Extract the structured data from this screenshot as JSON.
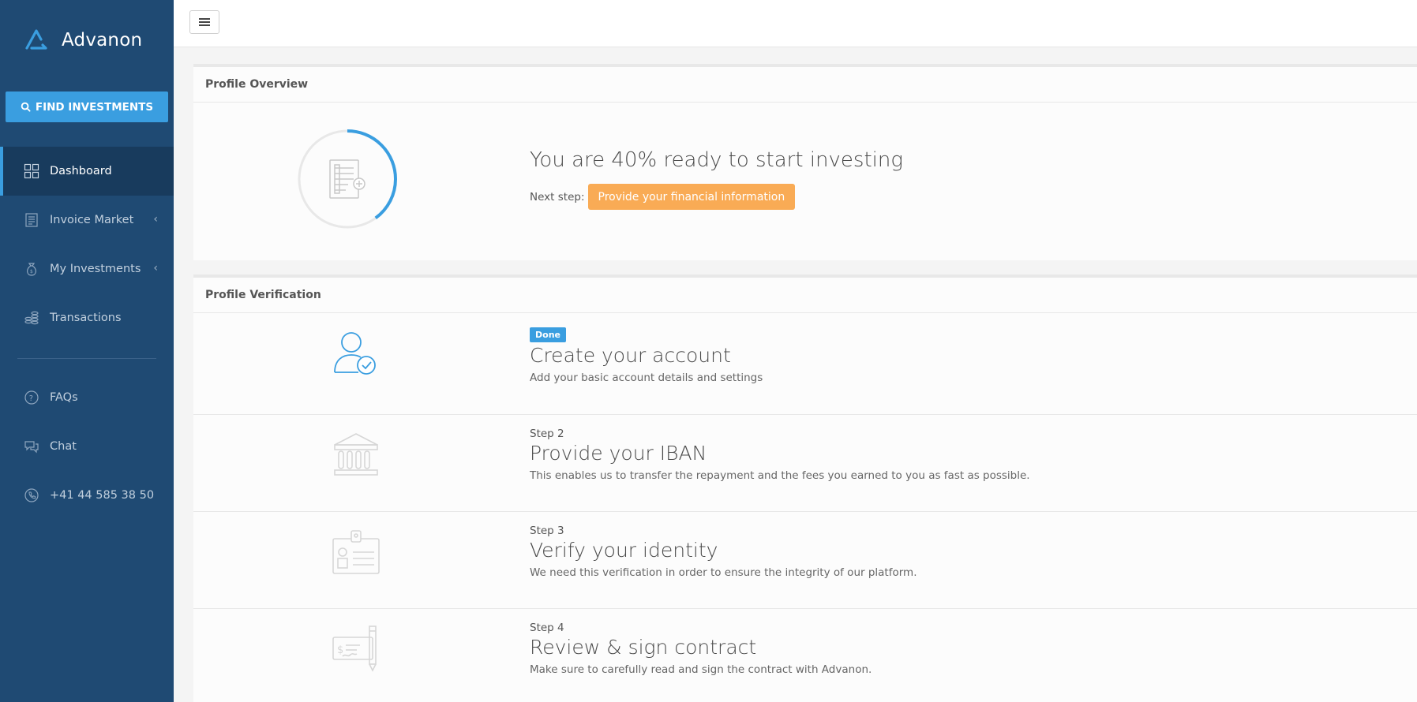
{
  "brand": {
    "name": "Advanon"
  },
  "sidebar": {
    "find_button": "FIND INVESTMENTS",
    "items": [
      {
        "label": "Dashboard",
        "icon": "dashboard-grid-icon",
        "active": true
      },
      {
        "label": "Invoice Market",
        "icon": "invoice-icon",
        "has_submenu": true
      },
      {
        "label": "My Investments",
        "icon": "money-bag-icon",
        "has_submenu": true
      },
      {
        "label": "Transactions",
        "icon": "coins-icon"
      }
    ],
    "secondary": [
      {
        "label": "FAQs",
        "icon": "question-circle-icon"
      },
      {
        "label": "Chat",
        "icon": "chat-icon"
      },
      {
        "label": "+41 44 585 38 50",
        "icon": "phone-icon"
      }
    ],
    "submenu_chevron": "‹"
  },
  "overview": {
    "heading": "Profile Overview",
    "ready_text": "You are 40% ready to start investing",
    "progress_percent": 40,
    "next_step_label": "Next step:",
    "next_step_button": "Provide your financial information"
  },
  "verification": {
    "heading": "Profile Verification",
    "steps": [
      {
        "badge": "Done",
        "title": "Create your account",
        "desc": "Add your basic account details and settings",
        "icon": "user-check-icon",
        "done": true
      },
      {
        "label": "Step 2",
        "title": "Provide your IBAN",
        "desc": "This enables us to transfer the repayment and the fees you earned to you as fast as possible.",
        "icon": "bank-icon"
      },
      {
        "label": "Step 3",
        "title": "Verify your identity",
        "desc": "We need this verification in order to ensure the integrity of our platform.",
        "icon": "id-card-icon"
      },
      {
        "label": "Step 4",
        "title": "Review & sign contract",
        "desc": "Make sure to carefully read and sign the contract with Advanon.",
        "icon": "contract-icon"
      }
    ]
  },
  "colors": {
    "sidebar_bg": "#1f4a73",
    "sidebar_active": "#183b5d",
    "accent": "#3a9ee0",
    "next_button": "#f9ab55"
  }
}
